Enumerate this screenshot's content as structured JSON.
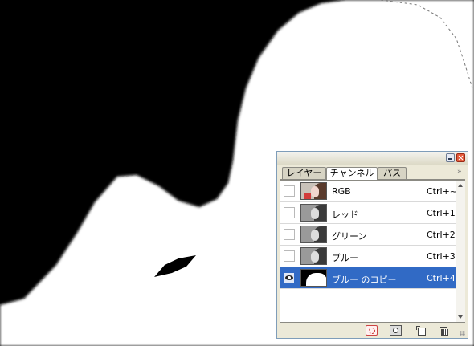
{
  "palette": {
    "canvas_bg": "#000000",
    "mask_white": "#ffffff",
    "selection_blue": "#316ac5",
    "arrow_red": "#e8382b"
  },
  "panel": {
    "tabs": [
      "レイヤー",
      "チャンネル",
      "パス"
    ],
    "active_tab": "チャンネル",
    "flyout_glyph": "»",
    "channels": [
      {
        "name": "RGB",
        "shortcut": "Ctrl+~",
        "visible": false,
        "thumb": "color"
      },
      {
        "name": "レッド",
        "shortcut": "Ctrl+1",
        "visible": false,
        "thumb": "gray"
      },
      {
        "name": "グリーン",
        "shortcut": "Ctrl+2",
        "visible": false,
        "thumb": "gray"
      },
      {
        "name": "ブルー",
        "shortcut": "Ctrl+3",
        "visible": false,
        "thumb": "gray"
      },
      {
        "name": "ブルー のコピー",
        "shortcut": "Ctrl+4",
        "visible": true,
        "thumb": "mask",
        "selected": true
      }
    ],
    "bottom_buttons": [
      "load-selection",
      "save-selection",
      "new-channel",
      "delete-channel"
    ]
  }
}
